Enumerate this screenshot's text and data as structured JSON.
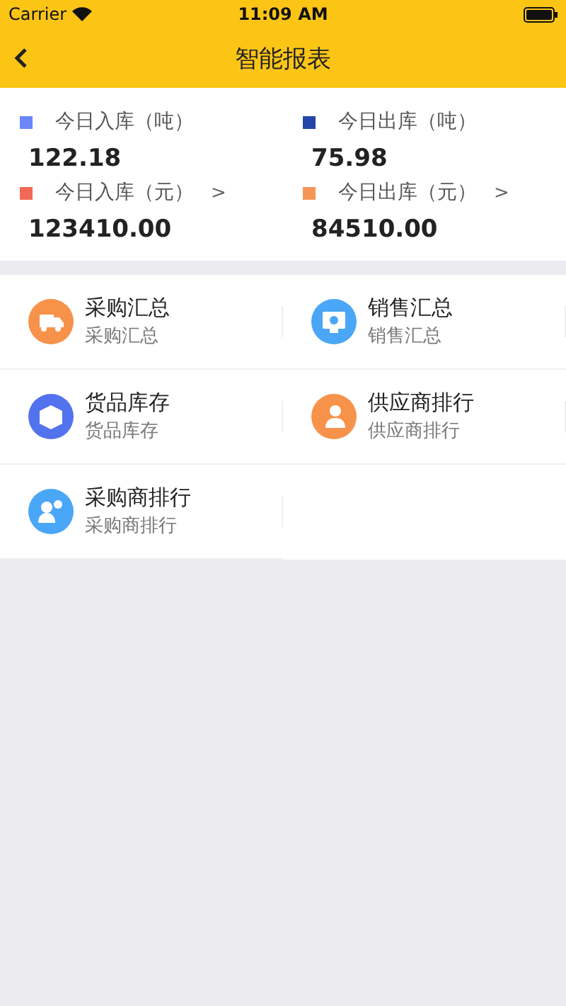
{
  "status_bar": {
    "carrier": "Carrier",
    "time": "11:09 AM"
  },
  "nav": {
    "title": "智能报表"
  },
  "stats": [
    {
      "label": "今日入库（吨）",
      "value": "122.18",
      "color": "#6b86f7",
      "chevron": false
    },
    {
      "label": "今日出库（吨）",
      "value": "75.98",
      "color": "#2446a8",
      "chevron": false
    },
    {
      "label": "今日入库（元）",
      "value": "123410.00",
      "color": "#f26a55",
      "chevron": true
    },
    {
      "label": "今日出库（元）",
      "value": "84510.00",
      "color": "#f59657",
      "chevron": true
    }
  ],
  "chevron": ">",
  "menu": [
    {
      "title": "采购汇总",
      "subtitle": "采购汇总",
      "kind": "truck",
      "color": "#f7924a"
    },
    {
      "title": "销售汇总",
      "subtitle": "销售汇总",
      "kind": "monitor",
      "color": "#4aa6f7"
    },
    {
      "title": "货品库存",
      "subtitle": "货品库存",
      "kind": "box",
      "color": "#5272ee"
    },
    {
      "title": "供应商排行",
      "subtitle": "供应商排行",
      "kind": "person",
      "color": "#f7924a"
    },
    {
      "title": "采购商排行",
      "subtitle": "采购商排行",
      "kind": "users",
      "color": "#4aa6f7"
    }
  ]
}
